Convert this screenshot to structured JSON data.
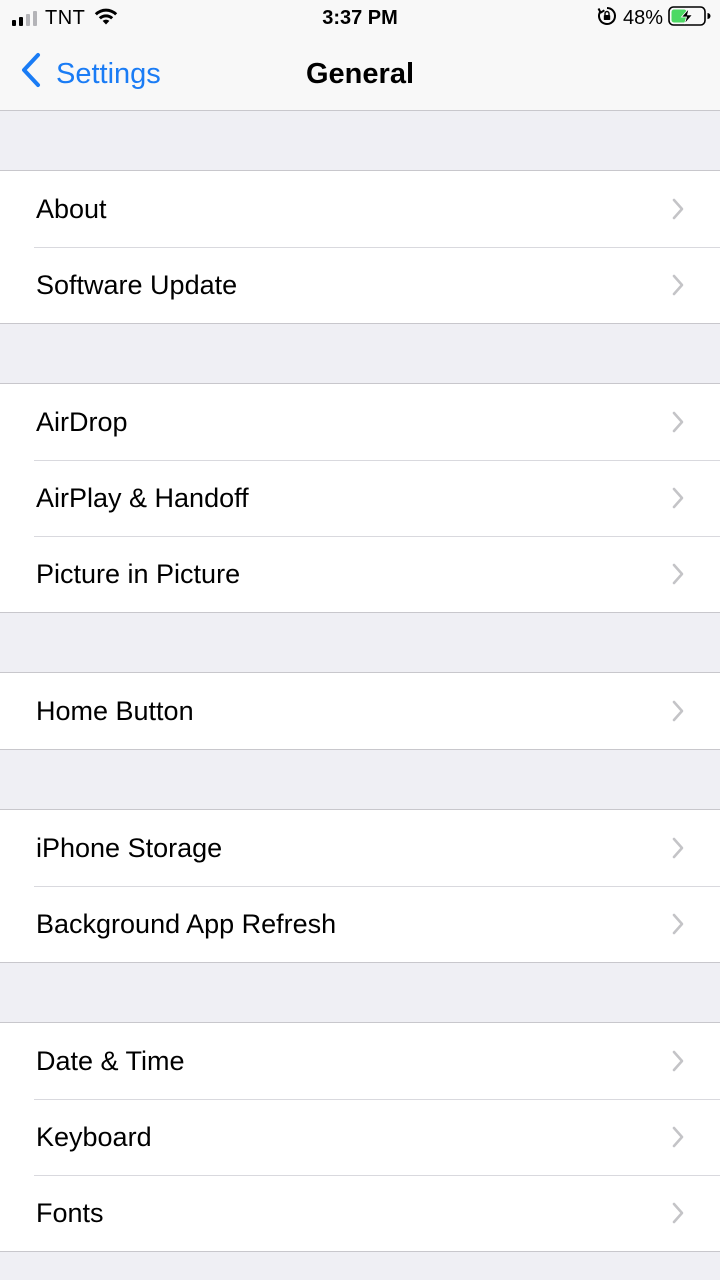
{
  "status_bar": {
    "carrier": "TNT",
    "time": "3:37 PM",
    "battery_percent": "48%",
    "signal_bars_active": 2,
    "signal_bars_total": 4,
    "charging": true
  },
  "nav": {
    "back_label": "Settings",
    "title": "General"
  },
  "groups": [
    {
      "items": [
        {
          "label": "About"
        },
        {
          "label": "Software Update"
        }
      ]
    },
    {
      "items": [
        {
          "label": "AirDrop"
        },
        {
          "label": "AirPlay & Handoff"
        },
        {
          "label": "Picture in Picture"
        }
      ]
    },
    {
      "items": [
        {
          "label": "Home Button"
        }
      ]
    },
    {
      "items": [
        {
          "label": "iPhone Storage"
        },
        {
          "label": "Background App Refresh"
        }
      ]
    },
    {
      "items": [
        {
          "label": "Date & Time"
        },
        {
          "label": "Keyboard"
        },
        {
          "label": "Fonts"
        }
      ]
    }
  ],
  "colors": {
    "accent": "#1a7cf5",
    "battery_fill": "#4cd964",
    "background": "#efeff4",
    "chevron": "#c4c4c7"
  }
}
